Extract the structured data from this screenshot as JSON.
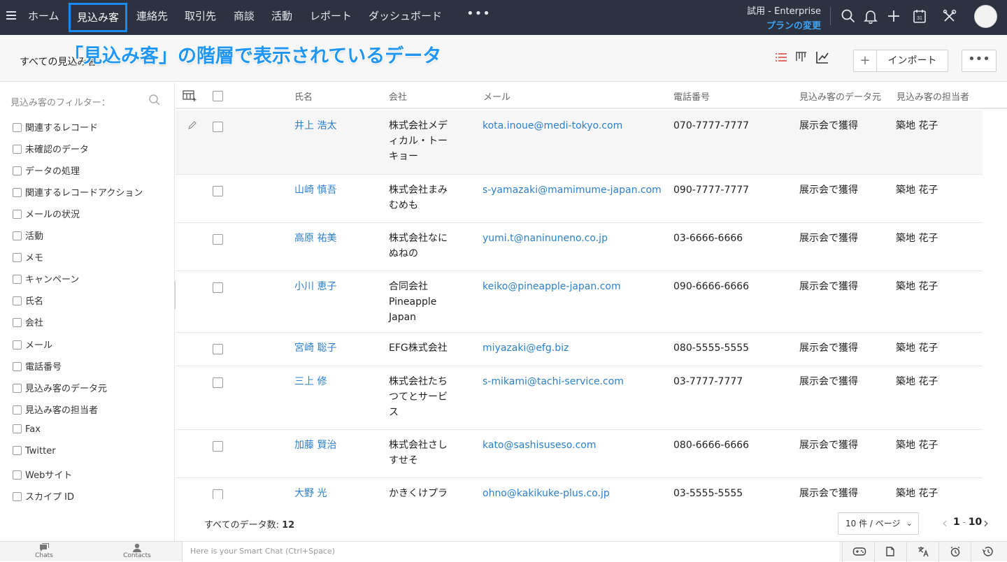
{
  "nav": {
    "items": [
      {
        "label": "ホーム"
      },
      {
        "label": "見込み客"
      },
      {
        "label": "連絡先"
      },
      {
        "label": "取引先"
      },
      {
        "label": "商談"
      },
      {
        "label": "活動"
      },
      {
        "label": "レポート"
      },
      {
        "label": "ダッシュボード"
      }
    ],
    "more_label": "•••",
    "trial_label": "試用 - Enterprise",
    "plan_label": "プランの変更",
    "icons": [
      "search-icon",
      "bell-icon",
      "plus-icon",
      "calendar-icon",
      "tools-icon"
    ],
    "calendar_day": "31"
  },
  "subheader": {
    "view_name": "すべての見込み客",
    "overlay_caption": "「見込み客」の階層で表示されているデータ",
    "plus_label": "+",
    "import_label": "インポート",
    "more_label": "•••"
  },
  "sidebar": {
    "title": "見込み客のフィルター：",
    "filters": [
      "関連するレコード",
      "未確認のデータ",
      "データの処理",
      "関連するレコードアクション",
      "メールの状況",
      "活動",
      "メモ",
      "キャンペーン",
      "氏名",
      "会社",
      "メール",
      "電話番号",
      "見込み客のデータ元",
      "見込み客の担当者",
      "Fax",
      "Twitter",
      "Webサイト",
      "スカイプ ID"
    ],
    "collapse_label": "‹"
  },
  "table": {
    "columns": [
      "氏名",
      "会社",
      "メール",
      "電話番号",
      "見込み客のデータ元",
      "見込み客の担当者"
    ],
    "rows": [
      {
        "name": "井上 浩太",
        "company": "株式会社メディカル・トーキョー",
        "email": "kota.inoue@medi-tokyo.com",
        "phone": "070-7777-7777",
        "source": "展示会で獲得",
        "owner": "築地 花子"
      },
      {
        "name": "山崎 慎吾",
        "company": "株式会社まみむめも",
        "email": "s-yamazaki@mamimume-japan.com",
        "phone": "090-7777-7777",
        "source": "展示会で獲得",
        "owner": "築地 花子"
      },
      {
        "name": "高原 祐美",
        "company": "株式会社なにぬねの",
        "email": "yumi.t@naninuneno.co.jp",
        "phone": "03-6666-6666",
        "source": "展示会で獲得",
        "owner": "築地 花子"
      },
      {
        "name": "小川 恵子",
        "company": "合同会社Pineapple Japan",
        "email": "keiko@pineapple-japan.com",
        "phone": "090-6666-6666",
        "source": "展示会で獲得",
        "owner": "築地 花子"
      },
      {
        "name": "宮崎 聡子",
        "company": "EFG株式会社",
        "email": "miyazaki@efg.biz",
        "phone": "080-5555-5555",
        "source": "展示会で獲得",
        "owner": "築地 花子"
      },
      {
        "name": "三上 修",
        "company": "株式会社たちつてとサービス",
        "email": "s-mikami@tachi-service.com",
        "phone": "03-7777-7777",
        "source": "展示会で獲得",
        "owner": "築地 花子"
      },
      {
        "name": "加藤 賢治",
        "company": "株式会社さしすせそ",
        "email": "kato@sashisuseso.com",
        "phone": "080-6666-6666",
        "source": "展示会で獲得",
        "owner": "築地 花子"
      },
      {
        "name": "大野 光",
        "company": "かきくけプラ",
        "email": "ohno@kakikuke-plus.co.jp",
        "phone": "03-5555-5555",
        "source": "展示会で獲得",
        "owner": "築地 花子"
      }
    ]
  },
  "footer": {
    "total_label": "すべてのデータ数:",
    "total_count": "12",
    "per_page": "10 件 / ページ",
    "range_start": "1",
    "range_sep": " - ",
    "range_end": "10"
  },
  "bottombar": {
    "chats_label": "Chats",
    "contacts_label": "Contacts",
    "smartchat_placeholder": "Here is your Smart Chat (Ctrl+Space)"
  },
  "colors": {
    "nav_bg": "#2d3240",
    "accent": "#1a8cf0",
    "link": "#2d7fcb"
  }
}
